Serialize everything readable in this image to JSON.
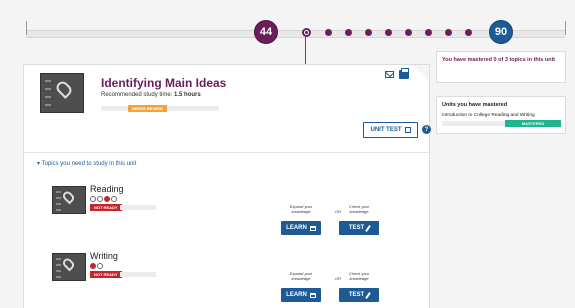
{
  "progress": {
    "start_value": "44",
    "end_value": "90",
    "step_count": 10,
    "current_step": 1,
    "accent_color": "#6b1d5a",
    "end_color": "#1e5b96"
  },
  "unit": {
    "title": "Identifying Main Ideas",
    "study_time_label": "Recommended study time:",
    "study_time_value": "1.5 hours",
    "badge": "NEEDS REVIEW",
    "badge_color": "#f4a23a",
    "unit_test_label": "UNIT TEST",
    "help_label": "?",
    "icon": "map-pin-book-icon"
  },
  "topics_header": "▾ Topics you need to study in this unit",
  "topics": [
    {
      "name": "Reading",
      "status": "NOT READY",
      "dots_filled": 1,
      "dots_total": 4,
      "learn_hint": "Expand your knowledge",
      "or_label": "OR",
      "test_hint": "Check your knowledge",
      "learn_label": "LEARN",
      "test_label": "TEST"
    },
    {
      "name": "Writing",
      "status": "NOT READY",
      "dots_filled": 1,
      "dots_total": 2,
      "learn_hint": "Expand your knowledge",
      "or_label": "OR",
      "test_hint": "Check your knowledge",
      "learn_label": "LEARN",
      "test_label": "TEST"
    }
  ],
  "sidebar": {
    "summary": "You have mastered 0 of 3 topics in this unit",
    "units_mastered_heading": "Units you have mastered",
    "mastered_units": [
      {
        "name": "Introduction to College Reading and Writing",
        "status": "MASTERED",
        "status_color": "#1fb58f"
      }
    ]
  }
}
